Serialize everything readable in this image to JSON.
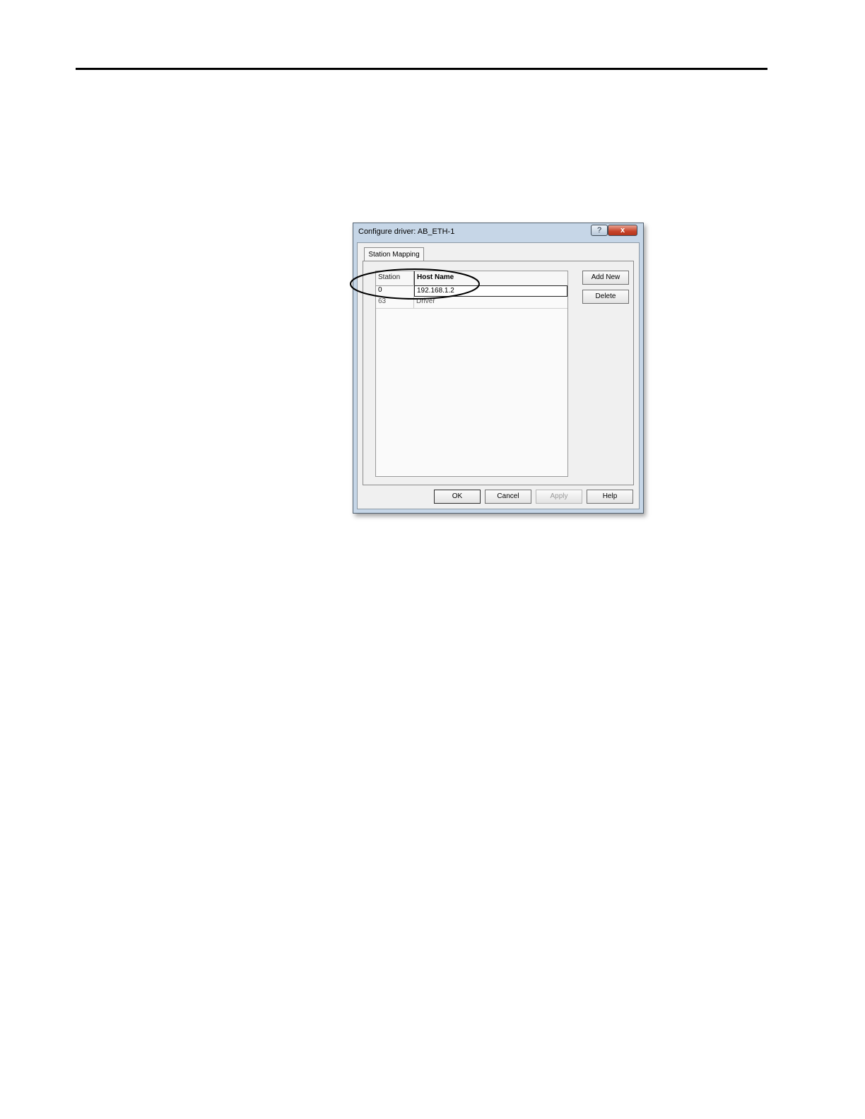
{
  "dialog": {
    "title": "Configure driver: AB_ETH-1",
    "help_glyph": "?",
    "close_glyph": "x"
  },
  "tab": {
    "label": "Station Mapping"
  },
  "table": {
    "headers": [
      "Station",
      "Host Name"
    ],
    "rows": [
      {
        "station": "0",
        "host": "192.168.1.2"
      },
      {
        "station": "63",
        "host": "Driver"
      }
    ]
  },
  "side_buttons": {
    "add_new": "Add New",
    "delete": "Delete"
  },
  "footer_buttons": {
    "ok": "OK",
    "cancel": "Cancel",
    "apply": "Apply",
    "help": "Help"
  }
}
